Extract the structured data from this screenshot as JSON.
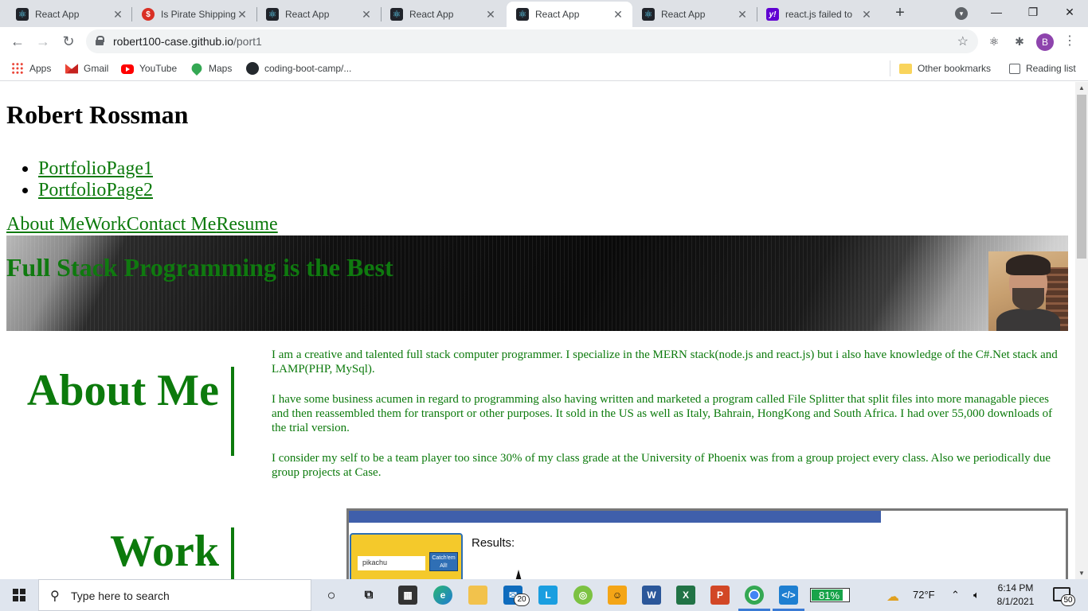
{
  "browser": {
    "tabs": [
      {
        "title": "React App",
        "favicon": "react-icon"
      },
      {
        "title": "Is Pirate Shipping",
        "favicon": "dollar-icon"
      },
      {
        "title": "React App",
        "favicon": "react-icon"
      },
      {
        "title": "React App",
        "favicon": "react-icon"
      },
      {
        "title": "React App",
        "favicon": "react-icon",
        "active": true
      },
      {
        "title": "React App",
        "favicon": "react-icon"
      },
      {
        "title": "react.js failed to",
        "favicon": "yahoo-icon"
      }
    ],
    "tab_close_glyph": "✕",
    "new_tab_glyph": "+",
    "url_host": "robert100-case.github.io",
    "url_path": "/port1",
    "profile_initial": "B",
    "bookmarks": [
      {
        "label": "Apps",
        "icon": "apps-grid-icon"
      },
      {
        "label": "Gmail",
        "icon": "gmail-icon"
      },
      {
        "label": "YouTube",
        "icon": "youtube-icon"
      },
      {
        "label": "Maps",
        "icon": "maps-icon"
      },
      {
        "label": "coding-boot-camp/...",
        "icon": "github-icon"
      }
    ],
    "other_bookmarks": "Other bookmarks",
    "reading_list": "Reading list"
  },
  "page": {
    "name": "Robert Rossman",
    "portfolio_links": [
      "PortfolioPage1",
      "PortfolioPage2"
    ],
    "nav": {
      "about": "About Me",
      "work": "Work",
      "contact": "Contact Me",
      "resume": "Resume"
    },
    "hero_title": "Full Stack Programming is the Best",
    "about_heading": "About Me",
    "about_paragraphs": [
      "I am a creative and talented full stack computer programmer. I specialize in the MERN stack(node.js and react.js) but i also have knowledge of the C#.Net stack and LAMP(PHP, MySql).",
      "I have some business acumen in regard to programming also having written and marketed a program called File Splitter that split files into more managable pieces and then reassembled them for transport or other purposes. It sold in the US as well as Italy, Bahrain, HongKong and South Africa. I had over 55,000 downloads of the trial version.",
      "I consider my self to be a team player too since 30% of my class grade at the University of Phoenix was from a group project every class. Also we periodically due group projects at Case."
    ],
    "work_heading": "Work",
    "work_preview": {
      "input_value": "pikachu",
      "button_label": "Catch'em All!",
      "results_label": "Results:"
    }
  },
  "taskbar": {
    "search_placeholder": "Type here to search",
    "mail_badge": "20",
    "battery_percent": "81%",
    "battery_level": 0.81,
    "weather": "72°F",
    "time": "6:14 PM",
    "date": "8/1/2021",
    "notification_count": "50",
    "pinned_apps": [
      "cortana-icon",
      "task-view-icon",
      "store-icon",
      "edge-icon",
      "file-explorer-icon",
      "mail-icon",
      "l-app-icon",
      "green-app-icon",
      "game-icon",
      "word-icon",
      "excel-icon",
      "powerpoint-icon",
      "chrome-icon",
      "vscode-icon"
    ]
  }
}
